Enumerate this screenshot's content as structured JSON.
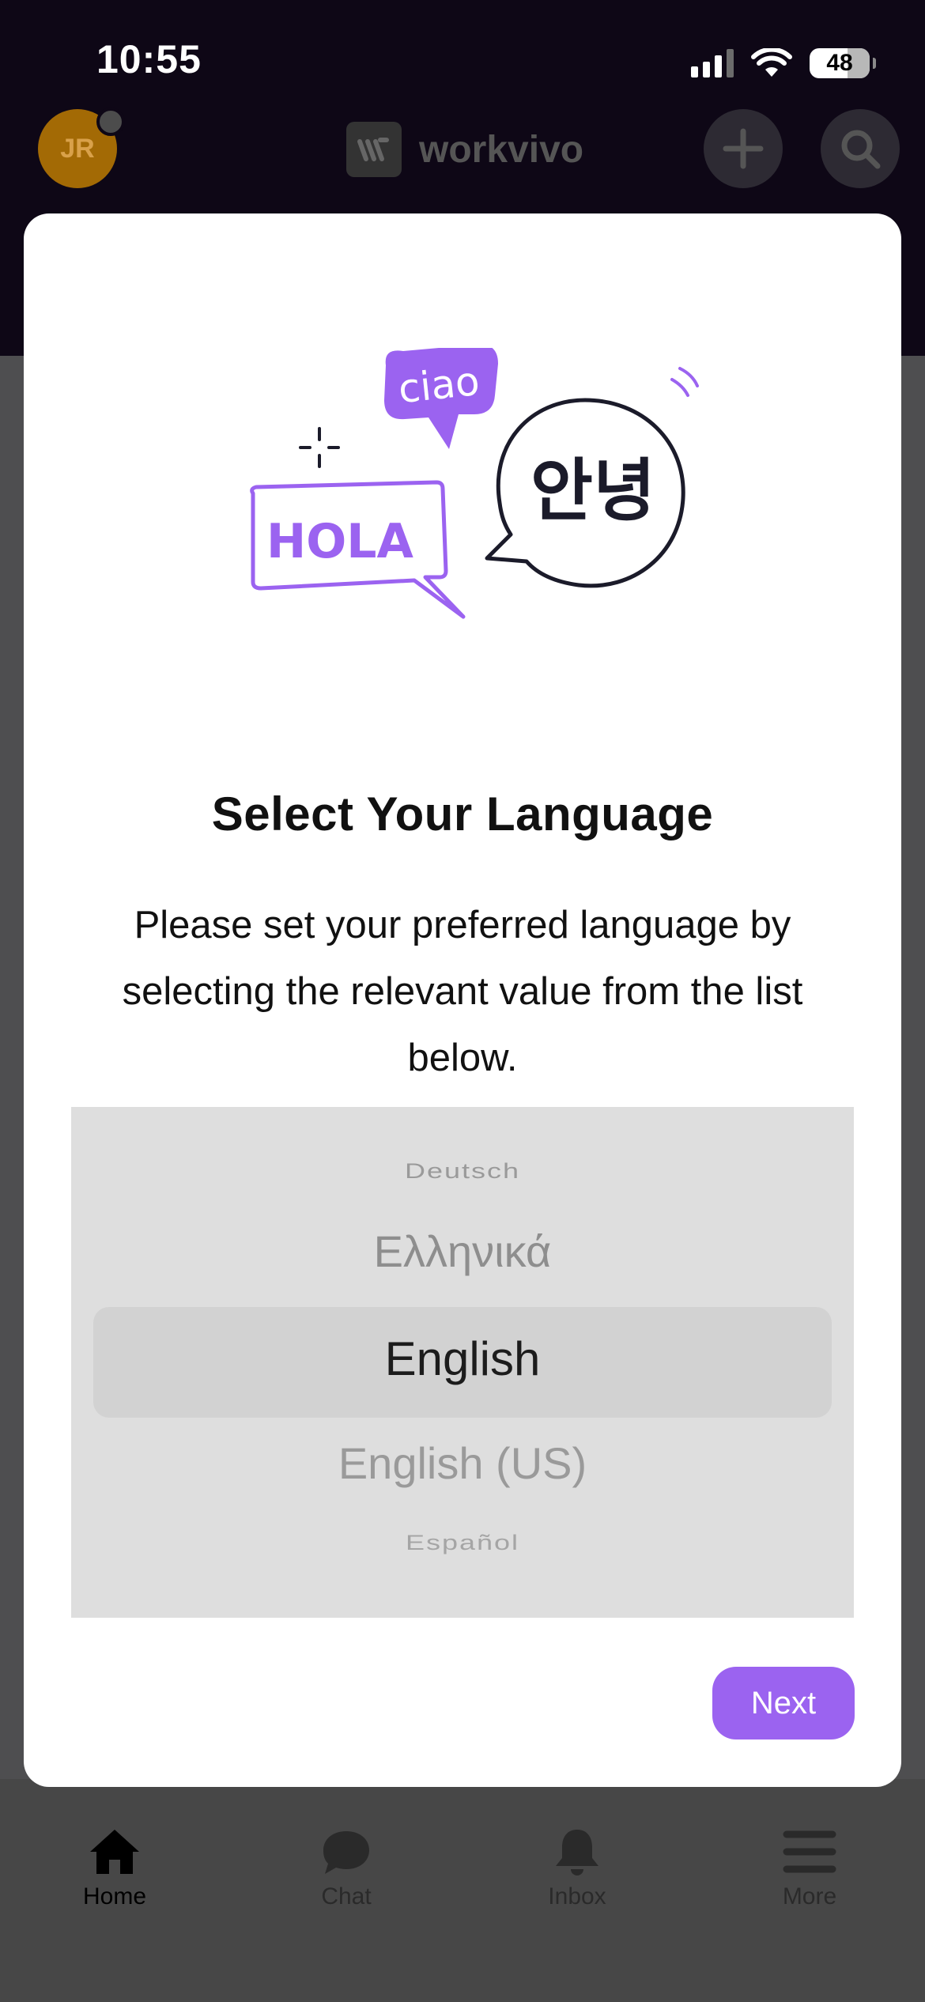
{
  "status_bar": {
    "time": "10:55",
    "battery": "48"
  },
  "header": {
    "avatar_initials": "JR",
    "brand_name": "workvivo"
  },
  "modal": {
    "title": "Select Your Language",
    "description": "Please set your preferred language by selecting the relevant value from the list below.",
    "illustration_words": [
      "ciao",
      "HOLA",
      "안녕"
    ],
    "picker": {
      "options": [
        "Deutsch",
        "Ελληνικά",
        "English",
        "English (US)",
        "Español"
      ],
      "selected": "English"
    },
    "next_label": "Next"
  },
  "tabbar": {
    "items": [
      {
        "label": "Home",
        "icon": "home-icon",
        "active": true
      },
      {
        "label": "Chat",
        "icon": "chat-icon",
        "active": false
      },
      {
        "label": "Inbox",
        "icon": "bell-icon",
        "active": false
      },
      {
        "label": "More",
        "icon": "menu-icon",
        "active": false
      }
    ]
  },
  "colors": {
    "accent": "#9b63f0",
    "header_bg": "#0e0716",
    "overlay_bg": "#4e4e50",
    "avatar": "#a36a05"
  }
}
